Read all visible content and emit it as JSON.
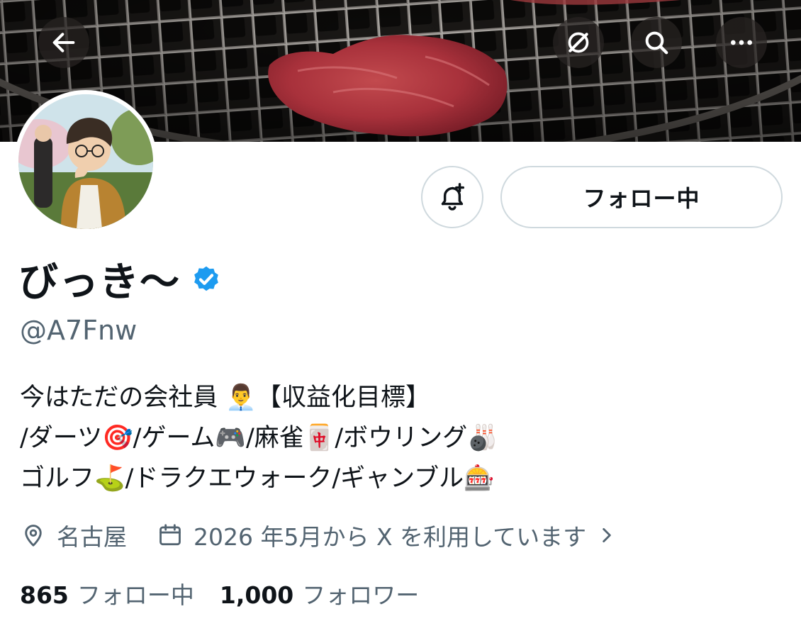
{
  "header": {
    "back_icon": "arrow-left-icon",
    "grok_icon": "grok-icon",
    "search_icon": "search-icon",
    "more_icon": "more-horizontal-icon"
  },
  "banner": {
    "description_colors": {
      "grill": "#1b1917",
      "meat": "#b3333e"
    }
  },
  "profile": {
    "display_name": "びっき〜",
    "handle": "@A7Fnw",
    "verified": true,
    "follow_button_label": "フォロー中",
    "bio": [
      "今はただの会社員 👨‍💼【収益化目標】",
      "/ダーツ🎯/ゲーム🎮/麻雀🀄/ボウリング🎳",
      "ゴルフ⛳/ドラクエウォーク/ギャンブル🎰"
    ],
    "location": "名古屋",
    "joined": "2026 年5月から X を利用しています",
    "following_count": "865",
    "following_label": "フォロー中",
    "followers_count": "1,000",
    "followers_label": "フォロワー"
  },
  "colors": {
    "text_primary": "#0f1419",
    "text_secondary": "#536471",
    "border": "#cfd9de",
    "verified_blue": "#1d9bf0"
  }
}
